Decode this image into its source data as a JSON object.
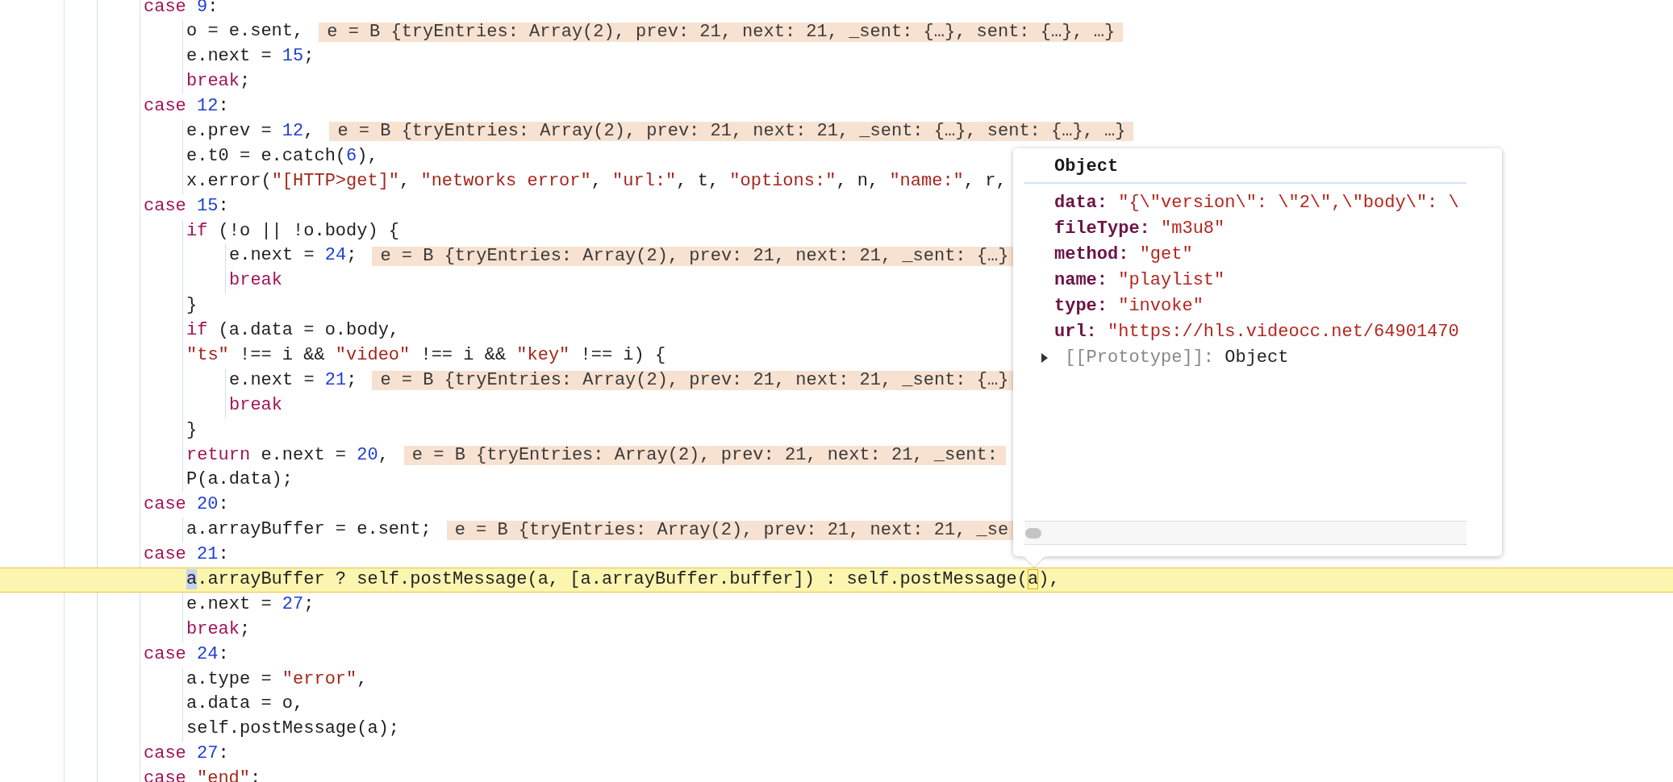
{
  "editor": {
    "lines": [
      {
        "current": false,
        "tokens": [
          {
            "kind": "kw",
            "text": "case "
          },
          {
            "kind": "num",
            "text": "9"
          },
          {
            "kind": "txt",
            "text": ":"
          }
        ],
        "children": [
          {
            "current": false,
            "tokens": [
              {
                "kind": "txt",
                "text": "o = e.sent,"
              }
            ],
            "inline_value": "e = B {tryEntries: Array(2), prev: 21, next: 21, _sent: {…}, sent: {…}, …}"
          },
          {
            "current": false,
            "tokens": [
              {
                "kind": "txt",
                "text": "e.next = "
              },
              {
                "kind": "num",
                "text": "15"
              },
              {
                "kind": "txt",
                "text": ";"
              }
            ]
          },
          {
            "current": false,
            "tokens": [
              {
                "kind": "kw",
                "text": "break"
              },
              {
                "kind": "txt",
                "text": ";"
              }
            ]
          }
        ]
      },
      {
        "current": false,
        "tokens": [
          {
            "kind": "kw",
            "text": "case "
          },
          {
            "kind": "num",
            "text": "12"
          },
          {
            "kind": "txt",
            "text": ":"
          }
        ],
        "children": [
          {
            "current": false,
            "tokens": [
              {
                "kind": "txt",
                "text": "e.prev = "
              },
              {
                "kind": "num",
                "text": "12"
              },
              {
                "kind": "txt",
                "text": ","
              }
            ],
            "inline_value": "e = B {tryEntries: Array(2), prev: 21, next: 21, _sent: {…}, sent: {…}, …}"
          },
          {
            "current": false,
            "tokens": [
              {
                "kind": "txt",
                "text": "e.t0 = e.catch("
              },
              {
                "kind": "num",
                "text": "6"
              },
              {
                "kind": "txt",
                "text": "),"
              }
            ]
          },
          {
            "current": false,
            "tokens": [
              {
                "kind": "txt",
                "text": "x.error("
              },
              {
                "kind": "str",
                "text": "\"[HTTP>get]\""
              },
              {
                "kind": "txt",
                "text": ", "
              },
              {
                "kind": "str",
                "text": "\"networks error\""
              },
              {
                "kind": "txt",
                "text": ", "
              },
              {
                "kind": "str",
                "text": "\"url:\""
              },
              {
                "kind": "txt",
                "text": ", t, "
              },
              {
                "kind": "str",
                "text": "\"options:\""
              },
              {
                "kind": "txt",
                "text": ", n, "
              },
              {
                "kind": "str",
                "text": "\"name:\""
              },
              {
                "kind": "txt",
                "text": ", r,"
              }
            ]
          }
        ]
      },
      {
        "current": false,
        "tokens": [
          {
            "kind": "kw",
            "text": "case "
          },
          {
            "kind": "num",
            "text": "15"
          },
          {
            "kind": "txt",
            "text": ":"
          }
        ],
        "children": [
          {
            "current": false,
            "tokens": [
              {
                "kind": "kw",
                "text": "if"
              },
              {
                "kind": "txt",
                "text": " (!o || !o.body) {"
              }
            ],
            "children": [
              {
                "current": false,
                "tokens": [
                  {
                    "kind": "txt",
                    "text": "e.next = "
                  },
                  {
                    "kind": "num",
                    "text": "24"
                  },
                  {
                    "kind": "txt",
                    "text": ";"
                  }
                ],
                "inline_value": "e = B {tryEntries: Array(2), prev: 21, next: 21, _sent: {…}"
              },
              {
                "current": false,
                "tokens": [
                  {
                    "kind": "kw",
                    "text": "break"
                  }
                ]
              }
            ]
          },
          {
            "current": false,
            "tokens": [
              {
                "kind": "txt",
                "text": "}"
              }
            ]
          },
          {
            "current": false,
            "tokens": [
              {
                "kind": "kw",
                "text": "if"
              },
              {
                "kind": "txt",
                "text": " (a.data = o.body,"
              }
            ]
          },
          {
            "current": false,
            "tokens": [
              {
                "kind": "str",
                "text": "\"ts\""
              },
              {
                "kind": "txt",
                "text": " !== i && "
              },
              {
                "kind": "str",
                "text": "\"video\""
              },
              {
                "kind": "txt",
                "text": " !== i && "
              },
              {
                "kind": "str",
                "text": "\"key\""
              },
              {
                "kind": "txt",
                "text": " !== i) {"
              }
            ],
            "children": [
              {
                "current": false,
                "tokens": [
                  {
                    "kind": "txt",
                    "text": "e.next = "
                  },
                  {
                    "kind": "num",
                    "text": "21"
                  },
                  {
                    "kind": "txt",
                    "text": ";"
                  }
                ],
                "inline_value": "e = B {tryEntries: Array(2), prev: 21, next: 21, _sent: {…}"
              },
              {
                "current": false,
                "tokens": [
                  {
                    "kind": "kw",
                    "text": "break"
                  }
                ]
              }
            ]
          },
          {
            "current": false,
            "tokens": [
              {
                "kind": "txt",
                "text": "}"
              }
            ]
          },
          {
            "current": false,
            "tokens": [
              {
                "kind": "kw",
                "text": "return"
              },
              {
                "kind": "txt",
                "text": " e.next = "
              },
              {
                "kind": "num",
                "text": "20"
              },
              {
                "kind": "txt",
                "text": ","
              }
            ],
            "inline_value": "e = B {tryEntries: Array(2), prev: 21, next: 21, _sent:"
          },
          {
            "current": false,
            "tokens": [
              {
                "kind": "txt",
                "text": "P(a.data);"
              }
            ]
          }
        ]
      },
      {
        "current": false,
        "tokens": [
          {
            "kind": "kw",
            "text": "case "
          },
          {
            "kind": "num",
            "text": "20"
          },
          {
            "kind": "txt",
            "text": ":"
          }
        ],
        "children": [
          {
            "current": false,
            "tokens": [
              {
                "kind": "txt",
                "text": "a.arrayBuffer = e.sent;"
              }
            ],
            "inline_value": "e = B {tryEntries: Array(2), prev: 21, next: 21, _se"
          }
        ]
      },
      {
        "current": false,
        "tokens": [
          {
            "kind": "kw",
            "text": "case "
          },
          {
            "kind": "num",
            "text": "21"
          },
          {
            "kind": "txt",
            "text": ":"
          }
        ],
        "children": [
          {
            "current": true,
            "tokens": [
              {
                "kind": "sel",
                "text": "a"
              },
              {
                "kind": "txt",
                "text": ".arrayBuffer ? self.postMessage(a, [a.arrayBuffer.buffer]) : self.postMessage("
              },
              {
                "kind": "box",
                "text": "a"
              },
              {
                "kind": "txt",
                "text": "),"
              }
            ]
          },
          {
            "current": false,
            "tokens": [
              {
                "kind": "txt",
                "text": "e.next = "
              },
              {
                "kind": "num",
                "text": "27"
              },
              {
                "kind": "txt",
                "text": ";"
              }
            ]
          },
          {
            "current": false,
            "tokens": [
              {
                "kind": "kw",
                "text": "break"
              },
              {
                "kind": "txt",
                "text": ";"
              }
            ]
          }
        ]
      },
      {
        "current": false,
        "tokens": [
          {
            "kind": "kw",
            "text": "case "
          },
          {
            "kind": "num",
            "text": "24"
          },
          {
            "kind": "txt",
            "text": ":"
          }
        ],
        "children": [
          {
            "current": false,
            "tokens": [
              {
                "kind": "txt",
                "text": "a.type = "
              },
              {
                "kind": "str",
                "text": "\"error\""
              },
              {
                "kind": "txt",
                "text": ","
              }
            ]
          },
          {
            "current": false,
            "tokens": [
              {
                "kind": "txt",
                "text": "a.data = o,"
              }
            ]
          },
          {
            "current": false,
            "tokens": [
              {
                "kind": "txt",
                "text": "self.postMessage(a);"
              }
            ]
          }
        ]
      },
      {
        "current": false,
        "tokens": [
          {
            "kind": "kw",
            "text": "case "
          },
          {
            "kind": "num",
            "text": "27"
          },
          {
            "kind": "txt",
            "text": ":"
          }
        ]
      },
      {
        "current": false,
        "tokens": [
          {
            "kind": "kw",
            "text": "case "
          },
          {
            "kind": "str",
            "text": "\"end\""
          },
          {
            "kind": "txt",
            "text": ":"
          }
        ]
      }
    ]
  },
  "popover": {
    "title": "Object",
    "properties": [
      {
        "key": "data:",
        "value": "\"{\\\"version\\\": \\\"2\\\",\\\"body\\\": \\"
      },
      {
        "key": "fileType:",
        "value": "\"m3u8\""
      },
      {
        "key": "method:",
        "value": "\"get\""
      },
      {
        "key": "name:",
        "value": "\"playlist\""
      },
      {
        "key": "type:",
        "value": "\"invoke\""
      },
      {
        "key": "url:",
        "value": "\"https://hls.videocc.net/64901470"
      }
    ],
    "prototype": {
      "key": "[[Prototype]]:",
      "value": "Object",
      "expanded": false
    }
  }
}
